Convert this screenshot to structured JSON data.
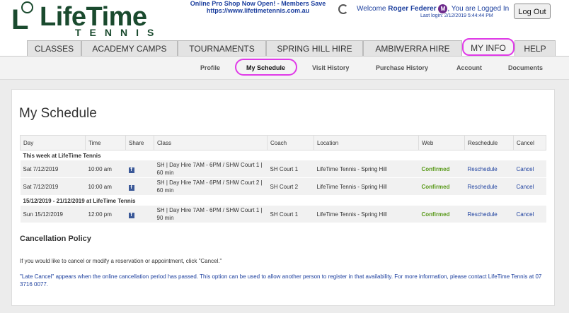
{
  "logo": {
    "name": "LifeTime",
    "sub": "TENNIS",
    "l": "L"
  },
  "promo": {
    "line1": "Online Pro Shop Now Open! - Members Save",
    "line2": "https://www.lifetimetennis.com.au"
  },
  "user": {
    "welcome": "Welcome",
    "name": "Roger Federer",
    "badge": "M",
    "logged": ", You are Logged In",
    "last_login": "Last login: 2/12/2019 5:44:44 PM",
    "logout": "Log Out"
  },
  "tabs": [
    "CLASSES",
    "ACADEMY CAMPS",
    "TOURNAMENTS",
    "SPRING HILL HIRE",
    "AMBIWERRA HIRE",
    "MY INFO",
    "HELP"
  ],
  "subnav": [
    "Profile",
    "My Schedule",
    "Visit History",
    "Purchase History",
    "Account",
    "Documents"
  ],
  "page": {
    "title": "My Schedule"
  },
  "table": {
    "headers": [
      "Day",
      "Time",
      "Share",
      "Class",
      "Coach",
      "Location",
      "Web",
      "Reschedule",
      "Cancel"
    ],
    "groups": [
      {
        "label": "This week at LifeTime Tennis",
        "rows": [
          {
            "day": "Sat 7/12/2019",
            "time": "10:00 am",
            "class": "SH | Day Hire 7AM - 6PM / SHW Court 1 | 60 min",
            "coach": "SH Court 1",
            "location": "LifeTime Tennis - Spring Hill",
            "web": "Confirmed",
            "reschedule": "Reschedule",
            "cancel": "Cancel"
          },
          {
            "day": "Sat 7/12/2019",
            "time": "10:00 am",
            "class": "SH | Day Hire 7AM - 6PM / SHW Court 2 | 60 min",
            "coach": "SH Court 2",
            "location": "LifeTime Tennis - Spring Hill",
            "web": "Confirmed",
            "reschedule": "Reschedule",
            "cancel": "Cancel"
          }
        ]
      },
      {
        "label": "15/12/2019 - 21/12/2019 at LifeTime Tennis",
        "rows": [
          {
            "day": "Sun 15/12/2019",
            "time": "12:00 pm",
            "class": "SH | Day Hire 7AM - 6PM / SHW Court 1 | 90 min",
            "coach": "SH Court 1",
            "location": "LifeTime Tennis - Spring Hill",
            "web": "Confirmed",
            "reschedule": "Reschedule",
            "cancel": "Cancel"
          }
        ]
      }
    ],
    "share_icon": "f"
  },
  "policy": {
    "title": "Cancellation Policy",
    "line1": "If you would like to cancel or modify a reservation or appointment, click \"Cancel.\"",
    "line2": "\"Late Cancel\" appears when the online cancellation period has passed. This option can be used to allow another person to register in that availability. For more information, please contact LifeTime Tennis at 07 3716 0077."
  }
}
